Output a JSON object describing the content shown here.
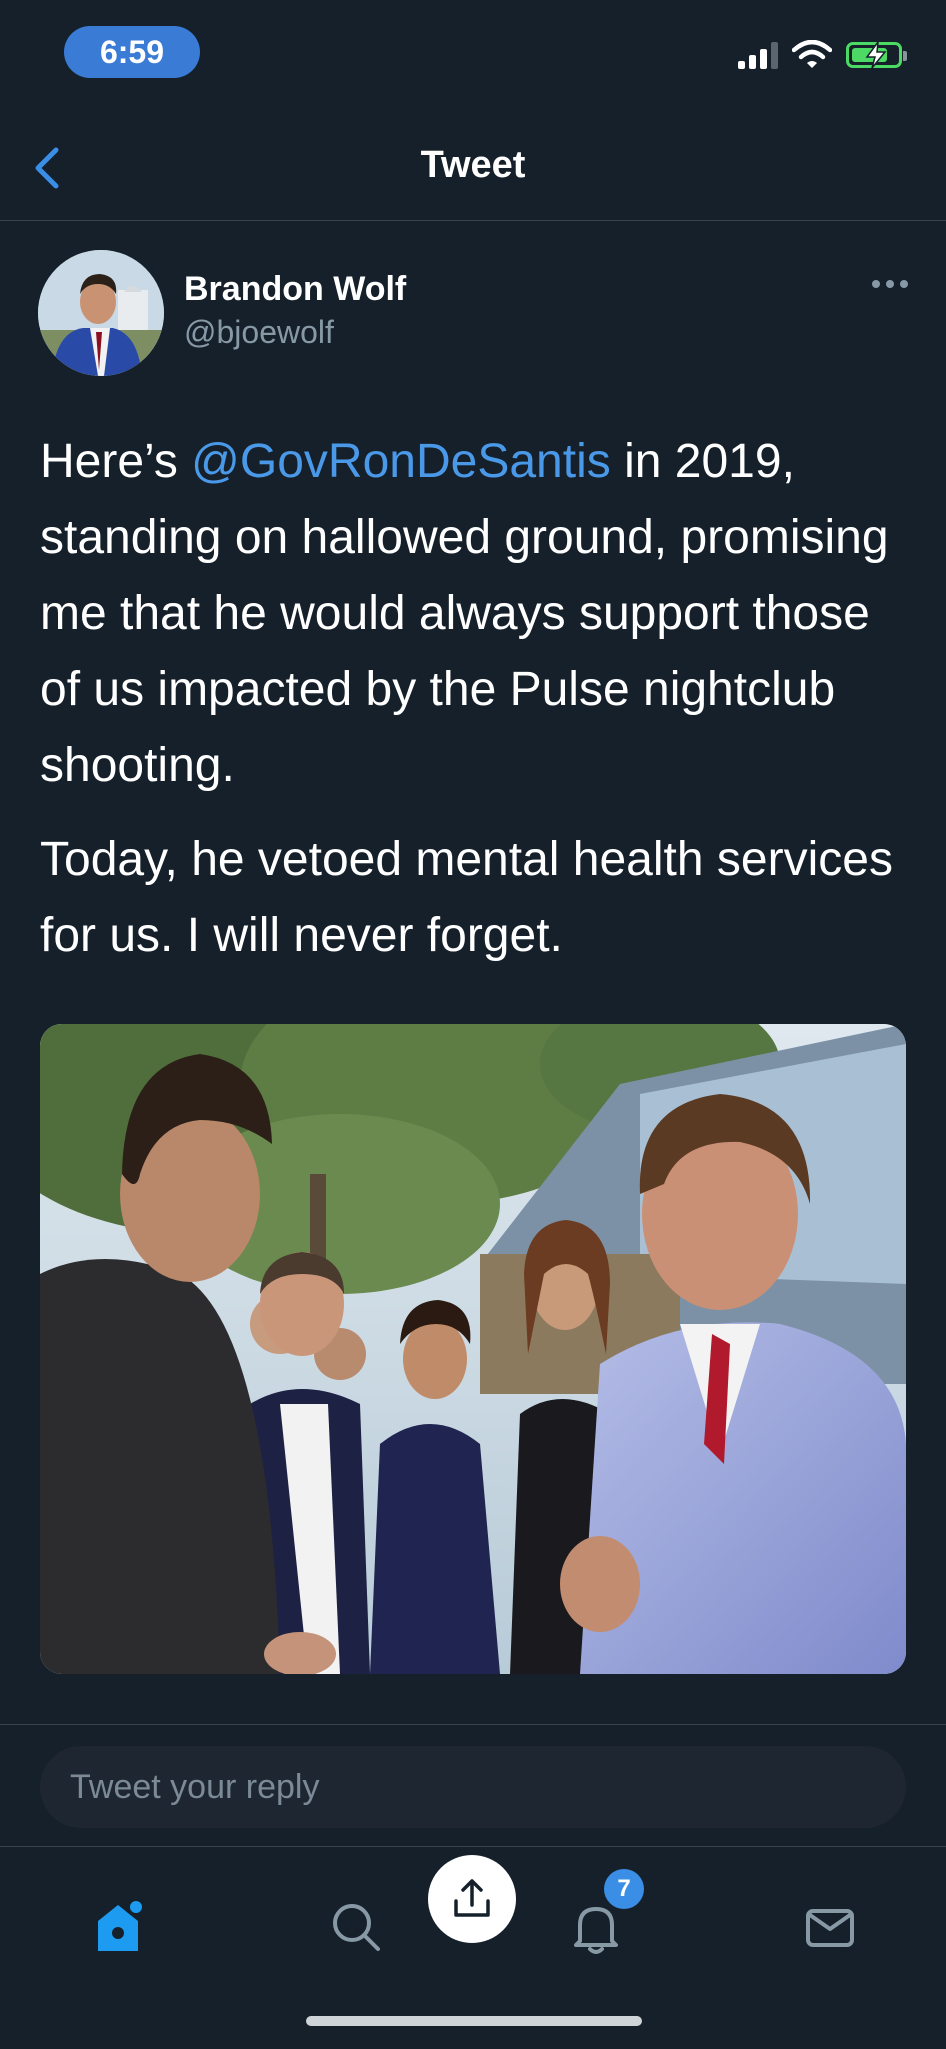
{
  "status_bar": {
    "time": "6:59"
  },
  "header": {
    "title": "Tweet"
  },
  "tweet": {
    "author_name": "Brandon Wolf",
    "author_handle": "@bjoewolf",
    "p1_before": "Here’s ",
    "p1_mention": "@GovRonDeSantis",
    "p1_after": " in 2019, standing on hallowed ground, promising me that he would always support those of us impacted by the Pulse nightclub shooting.",
    "p2": "Today, he vetoed mental health services for us. I will never forget."
  },
  "reply": {
    "placeholder": "Tweet your reply"
  },
  "tabbar": {
    "notification_count": "7"
  },
  "colors": {
    "background": "#15202b",
    "link": "#4a99e9",
    "accent": "#1da1f2"
  }
}
